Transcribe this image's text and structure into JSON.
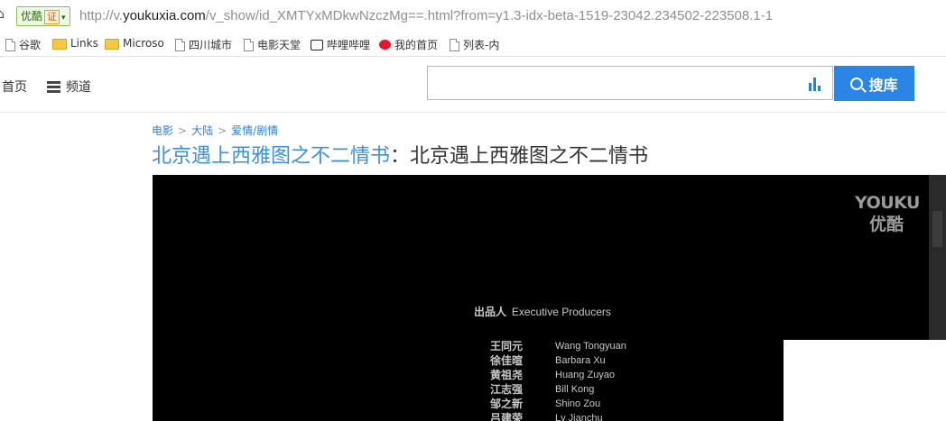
{
  "browser": {
    "badge_label": "优酷",
    "badge_verified": "证",
    "url_prefix": "http://v.",
    "url_domain": "youkuxia.com",
    "url_rest": "/v_show/id_XMTYxMDkwNzczMg==.html?from=y1.3-idx-beta-1519-23042.234502-223508.1-1"
  },
  "bookmarks": [
    {
      "label": "谷歌",
      "icon": "page-icon"
    },
    {
      "label": "Links",
      "icon": "folder-icon"
    },
    {
      "label": "Microso",
      "icon": "folder-icon"
    },
    {
      "label": "四川城市",
      "icon": "page-icon"
    },
    {
      "label": "电影天堂",
      "icon": "page-icon"
    },
    {
      "label": "哔哩哔哩",
      "icon": "bilibili-tv-icon"
    },
    {
      "label": "我的首页",
      "icon": "weibo-icon"
    },
    {
      "label": "列表-内",
      "icon": "page-icon"
    }
  ],
  "nav": {
    "home_label": "首页",
    "channel_label": "频道",
    "search_placeholder": "",
    "search_button_label": "搜库"
  },
  "breadcrumb": [
    "电影",
    "大陆",
    "爱情/剧情"
  ],
  "title": {
    "show_name": "北京遇上西雅图之不二情书",
    "separator": "：",
    "episode_name": "北京遇上西雅图之不二情书"
  },
  "video": {
    "logo_en": "YOUKU",
    "logo_cn": "优酷",
    "credits_heading_cn": "出品人",
    "credits_heading_en": "Executive Producers",
    "credits": [
      {
        "cn": "王同元",
        "en": "Wang Tongyuan"
      },
      {
        "cn": "徐佳暄",
        "en": "Barbara Xu"
      },
      {
        "cn": "黄祖尧",
        "en": "Huang Zuyao"
      },
      {
        "cn": "江志强",
        "en": "Bill Kong"
      },
      {
        "cn": "邹之新",
        "en": "Shino Zou"
      },
      {
        "cn": "吕建荣",
        "en": "Lv Jianchu"
      }
    ]
  },
  "colors": {
    "link": "#3f90db",
    "search_button": "#2b85e4",
    "video_bg": "#000000"
  }
}
